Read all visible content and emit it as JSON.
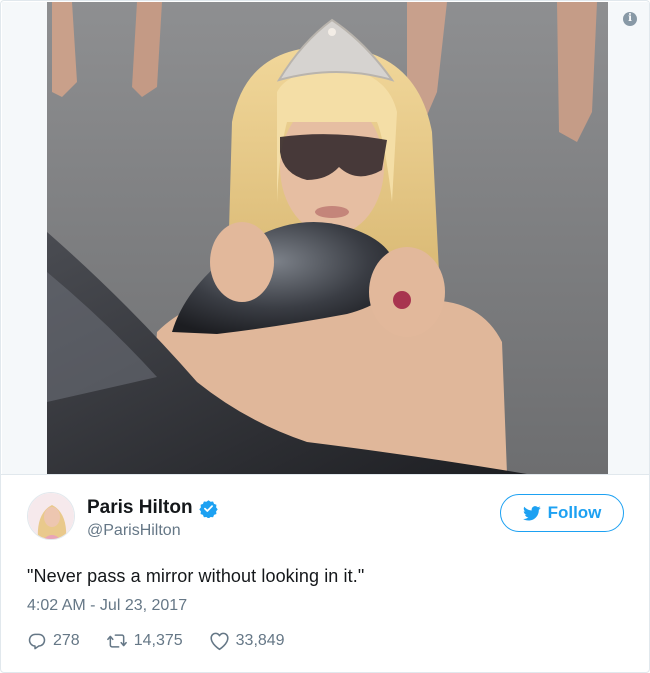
{
  "tweet": {
    "display_name": "Paris Hilton",
    "handle": "@ParisHilton",
    "text": "\"Never pass a mirror without looking in it.\"",
    "timestamp": "4:02 AM - Jul 23, 2017",
    "follow_label": "Follow",
    "counts": {
      "replies": "278",
      "retweets": "14,375",
      "likes": "33,849"
    }
  },
  "media": {
    "info_glyph": "i"
  },
  "icons": {
    "verified": "verified-badge-icon",
    "follow": "twitter-bird-icon",
    "reply": "reply-icon",
    "retweet": "retweet-icon",
    "like": "heart-icon",
    "info": "info-icon"
  },
  "colors": {
    "brand_blue": "#1da1f2",
    "muted_text": "#657786",
    "border": "#e1e8ed"
  }
}
